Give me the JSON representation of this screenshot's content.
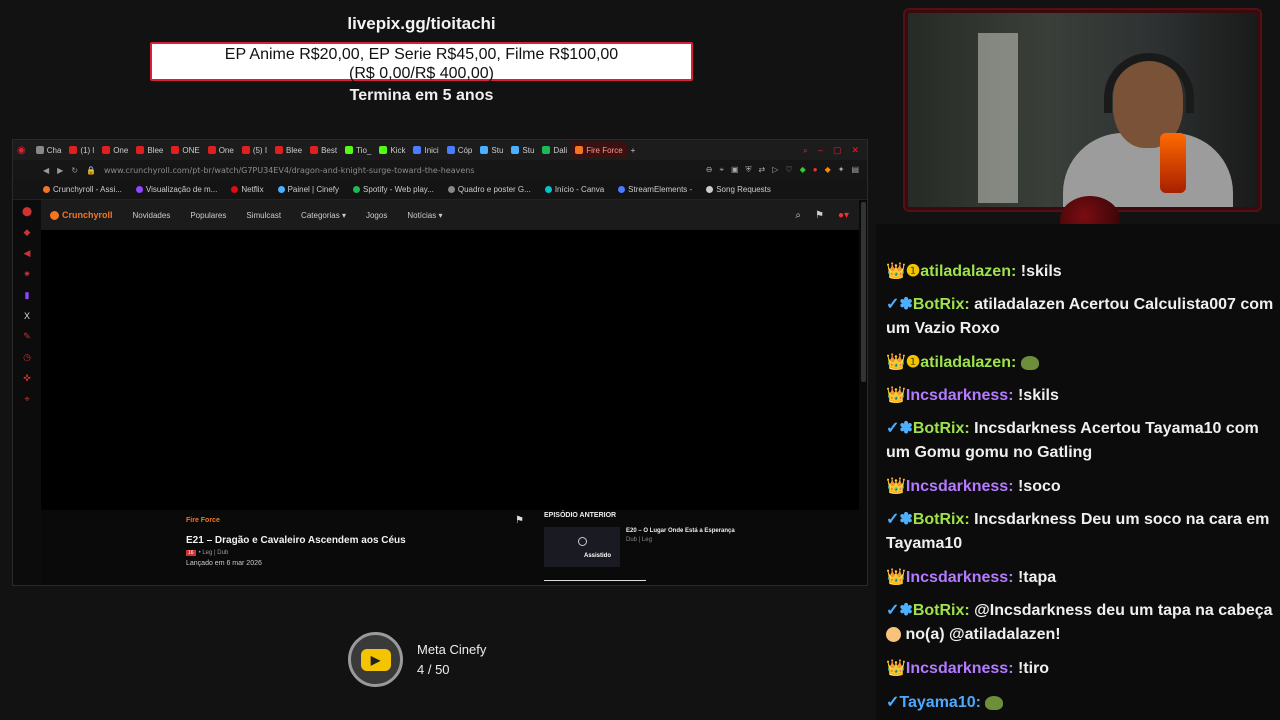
{
  "overlay": {
    "livepix_title": "livepix.gg/tioitachi",
    "prices_line1": "EP Anime R$20,00, EP Serie R$45,00, Filme R$100,00",
    "prices_line2": "(R$ 0,00/R$ 400,00)",
    "ends_in": "Termina em 5 anos"
  },
  "browser": {
    "tabs": [
      {
        "label": "Cha",
        "color": "#888888"
      },
      {
        "label": "(1) l",
        "color": "#e02020"
      },
      {
        "label": "One",
        "color": "#e02020"
      },
      {
        "label": "Blee",
        "color": "#e02020"
      },
      {
        "label": "ONE",
        "color": "#e02020"
      },
      {
        "label": "One",
        "color": "#e02020"
      },
      {
        "label": "(5) I",
        "color": "#e02020"
      },
      {
        "label": "Blee",
        "color": "#e02020"
      },
      {
        "label": "Best",
        "color": "#e02020"
      },
      {
        "label": "Tio_",
        "color": "#53fc18"
      },
      {
        "label": "Kick",
        "color": "#53fc18"
      },
      {
        "label": "Inici",
        "color": "#4a7cff"
      },
      {
        "label": "Cóp",
        "color": "#4a7cff"
      },
      {
        "label": "Stu",
        "color": "#4ab0ff"
      },
      {
        "label": "Stu",
        "color": "#4ab0ff"
      },
      {
        "label": "Dali",
        "color": "#1db954"
      },
      {
        "label": "Fire Force",
        "color": "#f47521"
      }
    ],
    "url": "www.crunchyroll.com/pt-br/watch/G7PU34EV4/dragon-and-knight-surge-toward-the-heavens",
    "bookmarks": [
      {
        "label": "Crunchyroll - Assi...",
        "color": "#f47521"
      },
      {
        "label": "Visualização de m...",
        "color": "#9146ff"
      },
      {
        "label": "Netflix",
        "color": "#e50914"
      },
      {
        "label": "Painel | Cinefy",
        "color": "#4ab0ff"
      },
      {
        "label": "Spotify - Web play...",
        "color": "#1db954"
      },
      {
        "label": "Quadro e poster G...",
        "color": "#888888"
      },
      {
        "label": "Início - Canva",
        "color": "#00c4cc"
      },
      {
        "label": "StreamElements -",
        "color": "#4a7cff"
      },
      {
        "label": "Song Requests",
        "color": "#cccccc"
      }
    ],
    "crunchyroll": {
      "logo": "Crunchyroll",
      "nav": [
        "Novidades",
        "Populares",
        "Simulcast",
        "Categorias ▾",
        "Jogos",
        "Notícias ▾"
      ],
      "series": "Fire Force",
      "episode_title": "E21 – Dragão e Cavaleiro Ascendem aos Céus",
      "episode_meta": "• Leg | Dub",
      "episode_date": "Lançado em 6 mar 2026",
      "prev_heading": "EPISÓDIO ANTERIOR",
      "prev_title": "E20 – O Lugar Onde Está a Esperança",
      "prev_sub": "Dub | Leg",
      "prev_watched": "Assistido"
    }
  },
  "meta": {
    "title": "Meta Cinefy",
    "count": "4 / 50"
  },
  "chat": [
    {
      "prefix": "👑❶",
      "user": "atiladalazen:",
      "user_class": "u-green",
      "text": " !skils"
    },
    {
      "prefix": "✓✽",
      "user": "BotRix:",
      "user_class": "u-bot",
      "text": " atiladalazen Acertou Calculista007 com um Vazio Roxo"
    },
    {
      "prefix": "👑❶",
      "user": "atiladalazen:",
      "user_class": "u-green",
      "text": " "
    },
    {
      "prefix": "👑",
      "user": "Incsdarkness:",
      "user_class": "u-purple",
      "text": " !skils"
    },
    {
      "prefix": "✓✽",
      "user": "BotRix:",
      "user_class": "u-bot",
      "text": " Incsdarkness Acertou Tayama10 com um Gomu gomu no Gatling"
    },
    {
      "prefix": "👑",
      "user": "Incsdarkness:",
      "user_class": "u-purple",
      "text": " !soco"
    },
    {
      "prefix": "✓✽",
      "user": "BotRix:",
      "user_class": "u-bot",
      "text": " Incsdarkness Deu um soco na cara em Tayama10"
    },
    {
      "prefix": "👑",
      "user": "Incsdarkness:",
      "user_class": "u-purple",
      "text": " !tapa"
    },
    {
      "prefix": "✓✽",
      "user": "BotRix:",
      "user_class": "u-bot",
      "text": " @Incsdarkness deu um tapa na cabeça "
    },
    {
      "prefix": "👑",
      "user": "Incsdarkness:",
      "user_class": "u-purple",
      "text": " !tiro"
    },
    {
      "prefix": "✓",
      "user": "Tayama10:",
      "user_class": "u-taya",
      "text": " "
    }
  ],
  "chat_extra": {
    "angry_suffix": " no(a) @atiladalazen!"
  }
}
